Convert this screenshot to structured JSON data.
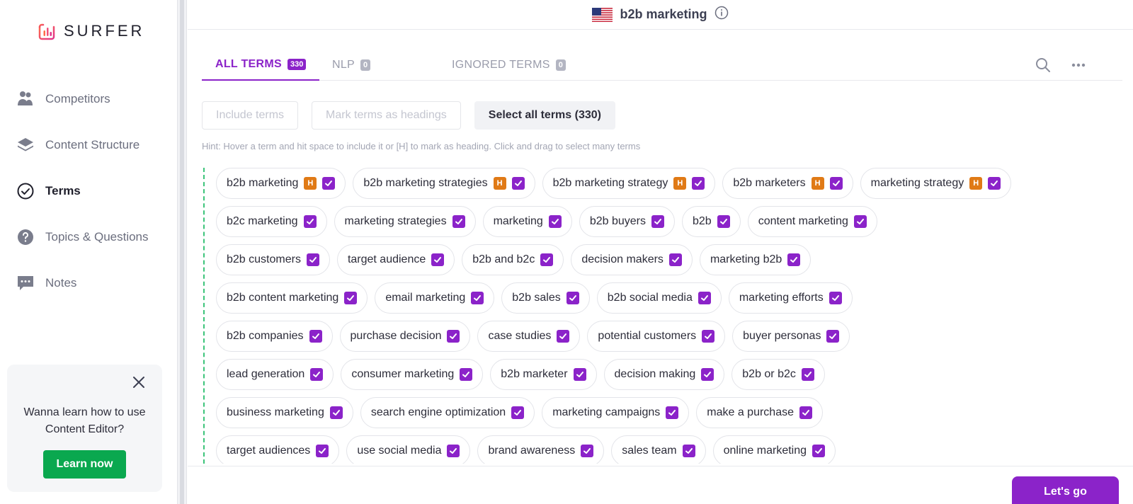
{
  "brand": {
    "name": "SURFER"
  },
  "sidebar": {
    "items": [
      {
        "label": "Competitors",
        "icon": "competitors-icon"
      },
      {
        "label": "Content Structure",
        "icon": "layers-icon"
      },
      {
        "label": "Terms",
        "icon": "check-circle-icon",
        "active": true
      },
      {
        "label": "Topics & Questions",
        "icon": "question-circle-icon"
      },
      {
        "label": "Notes",
        "icon": "chat-icon"
      }
    ]
  },
  "promo": {
    "text": "Wanna learn how to use Content Editor?",
    "button": "Learn now"
  },
  "topbar": {
    "keyword": "b2b marketing",
    "flag": "us-flag-icon"
  },
  "tabs": [
    {
      "label": "ALL TERMS",
      "count": "330",
      "active": true
    },
    {
      "label": "NLP",
      "count": "0"
    },
    {
      "label": "IGNORED TERMS",
      "count": "0"
    }
  ],
  "actions": {
    "include": "Include terms",
    "headings": "Mark terms as headings",
    "select_all": "Select all terms (330)"
  },
  "hint": "Hint: Hover a term and hit space to include it or [H] to mark as heading. Click and drag to select many terms",
  "terms": [
    [
      {
        "t": "b2b marketing",
        "h": true
      },
      {
        "t": "b2b marketing strategies",
        "h": true
      },
      {
        "t": "b2b marketing strategy",
        "h": true
      },
      {
        "t": "b2b marketers",
        "h": true
      },
      {
        "t": "marketing strategy",
        "h": true
      }
    ],
    [
      {
        "t": "b2c marketing"
      },
      {
        "t": "marketing strategies"
      },
      {
        "t": "marketing"
      },
      {
        "t": "b2b buyers"
      },
      {
        "t": "b2b"
      },
      {
        "t": "content marketing"
      }
    ],
    [
      {
        "t": "b2b customers"
      },
      {
        "t": "target audience"
      },
      {
        "t": "b2b and b2c"
      },
      {
        "t": "decision makers"
      },
      {
        "t": "marketing b2b"
      }
    ],
    [
      {
        "t": "b2b content marketing"
      },
      {
        "t": "email marketing"
      },
      {
        "t": "b2b sales"
      },
      {
        "t": "b2b social media"
      },
      {
        "t": "marketing efforts"
      }
    ],
    [
      {
        "t": "b2b companies"
      },
      {
        "t": "purchase decision"
      },
      {
        "t": "case studies"
      },
      {
        "t": "potential customers"
      },
      {
        "t": "buyer personas"
      }
    ],
    [
      {
        "t": "lead generation"
      },
      {
        "t": "consumer marketing"
      },
      {
        "t": "b2b marketer"
      },
      {
        "t": "decision making"
      },
      {
        "t": "b2b or b2c"
      }
    ],
    [
      {
        "t": "business marketing"
      },
      {
        "t": "search engine optimization"
      },
      {
        "t": "marketing campaigns"
      },
      {
        "t": "make a purchase"
      }
    ],
    [
      {
        "t": "target audiences"
      },
      {
        "t": "use social media"
      },
      {
        "t": "brand awareness"
      },
      {
        "t": "sales team"
      },
      {
        "t": "online marketing"
      }
    ]
  ],
  "heading_badge": "H",
  "footer": {
    "go_button": "Let's go"
  },
  "colors": {
    "accent": "#8b23c9",
    "heading": "#e07a16",
    "success": "#0aa84f"
  }
}
